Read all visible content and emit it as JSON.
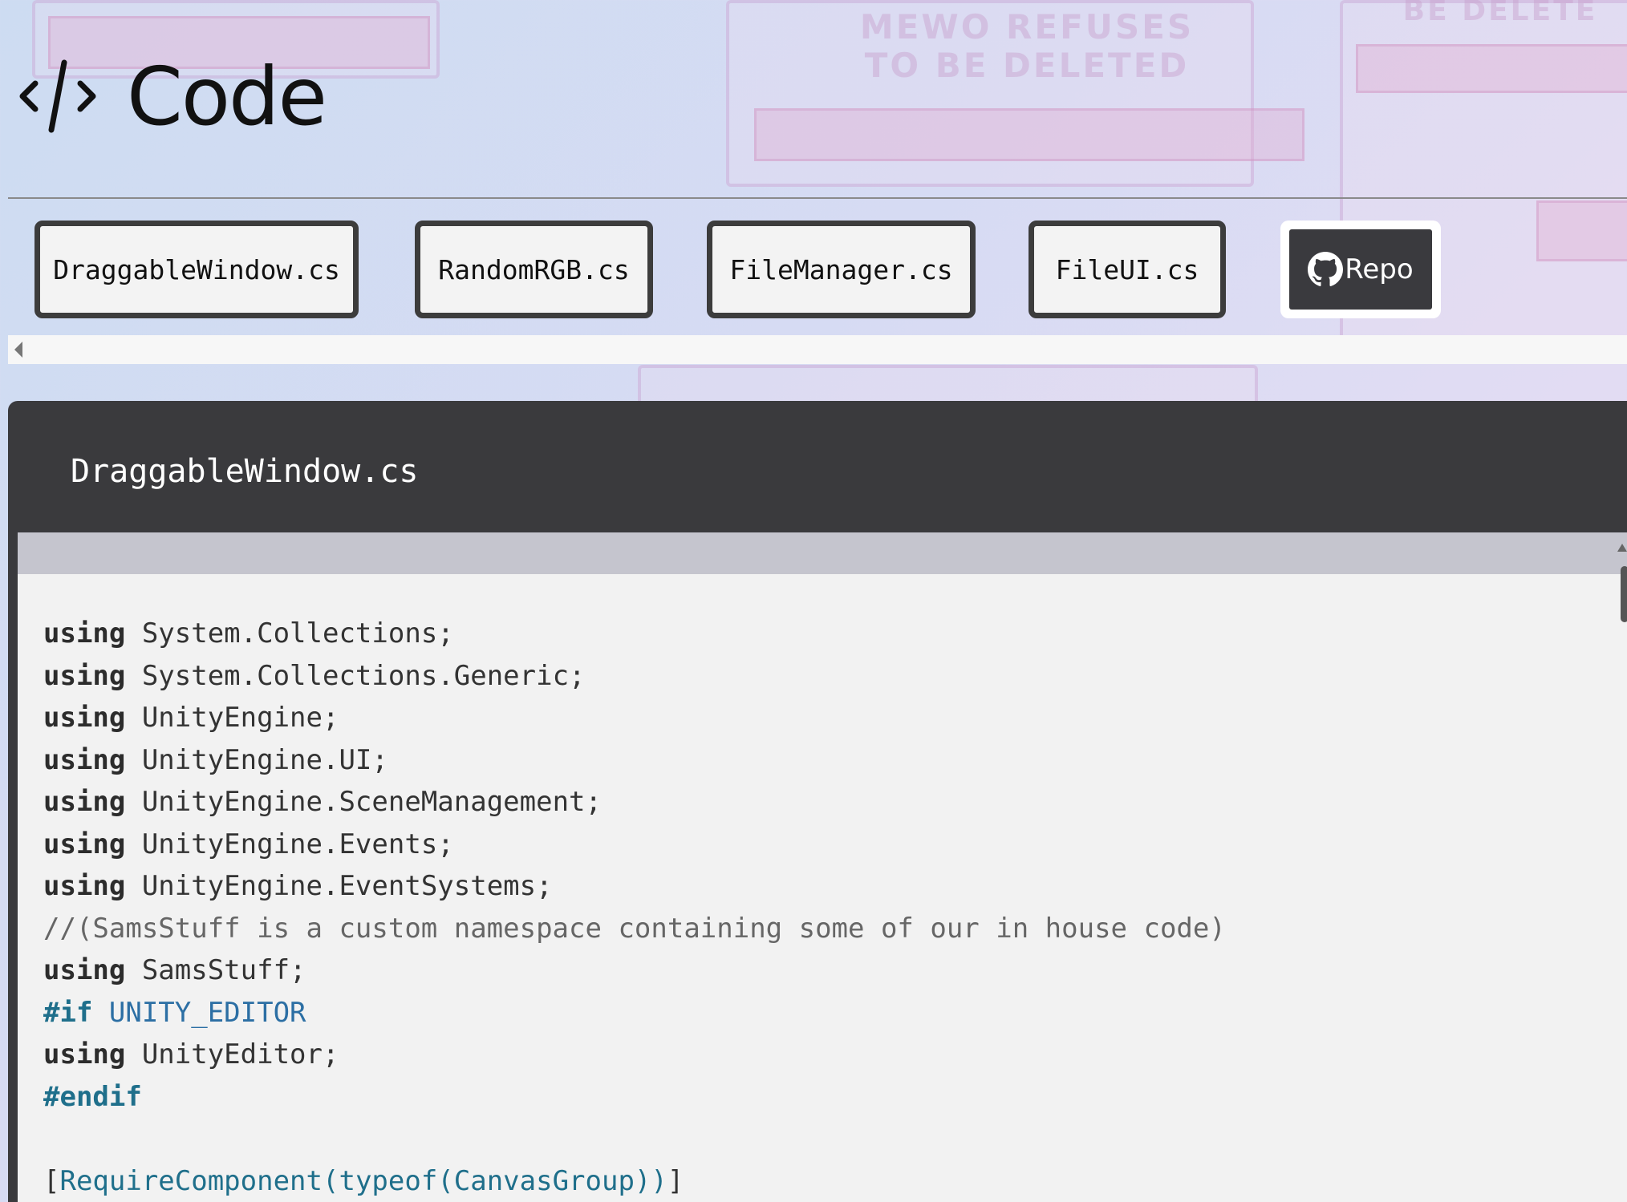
{
  "header": {
    "title": "Code",
    "icon": "code-brackets-icon"
  },
  "background": {
    "deco_text_1": "MEWO REFUSES TO BE DELETED",
    "deco_text_2": "BE DELETE"
  },
  "tabs": [
    {
      "label": "DraggableWindow.cs"
    },
    {
      "label": "RandomRGB.cs"
    },
    {
      "label": "FileManager.cs"
    },
    {
      "label": "FileUI.cs"
    }
  ],
  "repo_button": {
    "label": "Repo",
    "icon": "github-icon"
  },
  "panel": {
    "title": "DraggableWindow.cs"
  },
  "code": {
    "lines": [
      [
        {
          "t": "using",
          "c": "kw"
        },
        {
          "t": " System.Collections;",
          "c": ""
        }
      ],
      [
        {
          "t": "using",
          "c": "kw"
        },
        {
          "t": " System.Collections.Generic;",
          "c": ""
        }
      ],
      [
        {
          "t": "using",
          "c": "kw"
        },
        {
          "t": " UnityEngine;",
          "c": ""
        }
      ],
      [
        {
          "t": "using",
          "c": "kw"
        },
        {
          "t": " UnityEngine.UI;",
          "c": ""
        }
      ],
      [
        {
          "t": "using",
          "c": "kw"
        },
        {
          "t": " UnityEngine.SceneManagement;",
          "c": ""
        }
      ],
      [
        {
          "t": "using",
          "c": "kw"
        },
        {
          "t": " UnityEngine.Events;",
          "c": ""
        }
      ],
      [
        {
          "t": "using",
          "c": "kw"
        },
        {
          "t": " UnityEngine.EventSystems;",
          "c": ""
        }
      ],
      [
        {
          "t": "//(SamsStuff is a custom namespace containing some of our in house code)",
          "c": "cm"
        }
      ],
      [
        {
          "t": "using",
          "c": "kw"
        },
        {
          "t": " SamsStuff;",
          "c": ""
        }
      ],
      [
        {
          "t": "#if",
          "c": "pp"
        },
        {
          "t": " UNITY_EDITOR",
          "c": "pv"
        }
      ],
      [
        {
          "t": "using",
          "c": "kw"
        },
        {
          "t": " UnityEditor;",
          "c": ""
        }
      ],
      [
        {
          "t": "#endif",
          "c": "pp"
        }
      ],
      [
        {
          "t": "",
          "c": ""
        }
      ],
      [
        {
          "t": "[",
          "c": ""
        },
        {
          "t": "RequireComponent(typeof(CanvasGroup))",
          "c": "at"
        },
        {
          "t": "]",
          "c": ""
        }
      ]
    ]
  }
}
